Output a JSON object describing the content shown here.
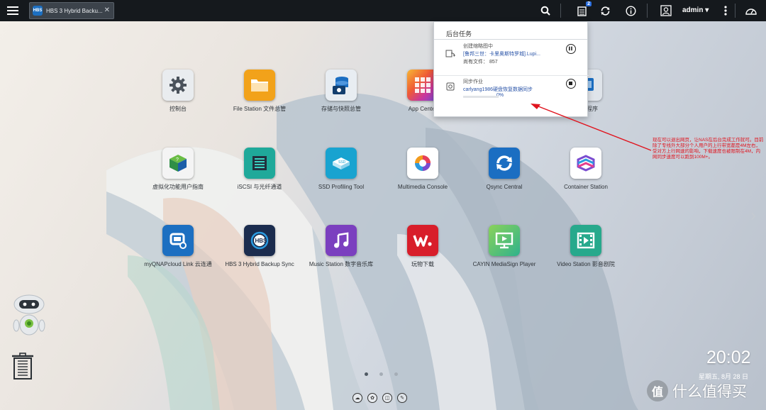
{
  "topbar": {
    "tab_label": "HBS 3 Hybrid Backu...",
    "tab_icon_text": "HBS",
    "task_badge": "2",
    "user": "admin ▾"
  },
  "desktop": {
    "row1": [
      {
        "label": "控制台",
        "icon": "gear-icon",
        "color": "#e9ecef"
      },
      {
        "label": "File Station 文件总管",
        "icon": "folder-icon",
        "color": "#f2a21a"
      },
      {
        "label": "存储与快照总管",
        "icon": "storage-icon",
        "color": "#e8edf2"
      },
      {
        "label": "App Center",
        "icon": "app-center-icon",
        "color": "#ef5b35"
      },
      {
        "label": "",
        "icon": "hidden-app-icon",
        "color": "#ffffff"
      },
      {
        "label": "应用程序",
        "icon": "apps-icon",
        "color": "#dfe4ea"
      }
    ],
    "row2": [
      {
        "label": "虚拟化功能用户指南",
        "icon": "virtualization-icon",
        "color": "#2f8f47"
      },
      {
        "label": "iSCSI 与光纤通道",
        "icon": "iscsi-icon",
        "color": "#1fa99a"
      },
      {
        "label": "SSD Profiling Tool",
        "icon": "ssd-icon",
        "color": "#18a3d0"
      },
      {
        "label": "Multimedia Console",
        "icon": "multimedia-icon",
        "color": "#ffffff"
      },
      {
        "label": "Qsync Central",
        "icon": "sync-icon",
        "color": "#1b6ec2"
      },
      {
        "label": "Container Station",
        "icon": "container-icon",
        "color": "#ffffff"
      }
    ],
    "row3": [
      {
        "label": "myQNAPcloud Link 云连通",
        "icon": "cloud-link-icon",
        "color": "#1c6fc1"
      },
      {
        "label": "HBS 3 Hybrid Backup Sync",
        "icon": "hbs-icon",
        "color": "#1b2c4e"
      },
      {
        "label": "Music Station 数字音乐库",
        "icon": "music-icon",
        "color": "#7b3fbf"
      },
      {
        "label": "玩物下载",
        "icon": "download-icon",
        "color": "#d81e2a"
      },
      {
        "label": "CAYIN MediaSign Player",
        "icon": "mediasign-icon",
        "color": "#3fb86a"
      },
      {
        "label": "Video Station 影音剧院",
        "icon": "video-icon",
        "color": "#27a98c"
      }
    ]
  },
  "tasks": {
    "title": "后台任务",
    "task1": {
      "line1": "创建缩略图中",
      "line2": "[鲁邦三世：卡里奥斯特罗城].Lupi...",
      "line3": "尚有文件： 857"
    },
    "task2": {
      "line1": "同步作业",
      "line2": "carlyang1986硬盘恢复数据同步",
      "percent": "0%",
      "progress": 0
    }
  },
  "annotation": "现在可以退出网页，让NAS在后台完成工作就可。目前除了专线外大部分个人用户的上行带宽都是4M左右，受对方上行网速的影响，下载速度也被限制在4M，内网同步速度可以跑到100M+。",
  "clock": {
    "time": "20:02",
    "date": "星期五, 8月 28 日"
  },
  "watermark": {
    "logo": "值",
    "text": "什么值得买"
  }
}
